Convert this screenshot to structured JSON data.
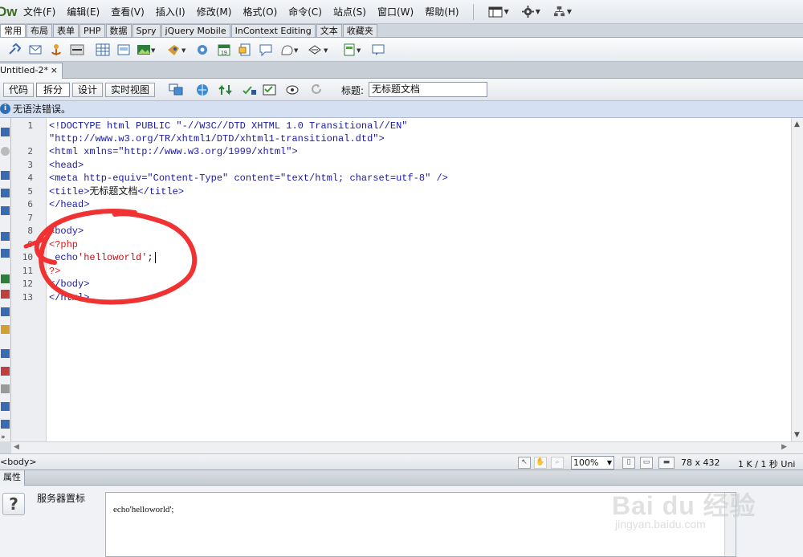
{
  "app": {
    "logo_text": "Dw"
  },
  "menu": {
    "items": [
      "文件(F)",
      "编辑(E)",
      "查看(V)",
      "插入(I)",
      "修改(M)",
      "格式(O)",
      "命令(C)",
      "站点(S)",
      "窗口(W)",
      "帮助(H)"
    ],
    "icons": [
      "layout-icon",
      "gear-icon",
      "site-icon"
    ]
  },
  "insert_bar": {
    "tabs": [
      "常用",
      "布局",
      "表单",
      "PHP",
      "数据",
      "Spry",
      "jQuery Mobile",
      "InContext Editing",
      "文本",
      "收藏夹"
    ],
    "active_tab": "常用"
  },
  "document": {
    "tab_label": "Untitled-2*",
    "close_glyph": "×"
  },
  "doc_toolbar": {
    "views": [
      "代码",
      "拆分",
      "设计",
      "实时视图"
    ],
    "active_view": "拆分",
    "title_label": "标题:",
    "title_value": "无标题文档"
  },
  "syntax_status": {
    "text": "无语法错误。"
  },
  "editor": {
    "line_numbers": [
      "1",
      "2",
      "3",
      "4",
      "5",
      "6",
      "7",
      "8",
      "9",
      "10",
      "11",
      "12",
      "13"
    ],
    "lines": {
      "l1a": "<!DOCTYPE html PUBLIC \"-//W3C//DTD XHTML 1.0 Transitional//EN\"",
      "l1b": "\"http://www.w3.org/TR/xhtml1/DTD/xhtml1-transitional.dtd\">",
      "l2": "<html xmlns=\"http://www.w3.org/1999/xhtml\">",
      "l3": "<head>",
      "l4": "<meta http-equiv=\"Content-Type\" content=\"text/html; charset=utf-8\" />",
      "l5a": "<title>",
      "l5b": "无标题文档",
      "l5c": "</title>",
      "l6": "</head>",
      "l8": "<body>",
      "l9": "<?php",
      "l10a": " echo",
      "l10b": "'helloworld'",
      "l10c": ";",
      "l11": "?>",
      "l12": "</body>",
      "l13": "</html>"
    },
    "annotation_color": "#f03232"
  },
  "status_bar": {
    "tag_selector": "<body>",
    "zoom": "100%",
    "window_size": "78 x 432",
    "file_size": "1 K / 1 秒 Uni"
  },
  "properties": {
    "header": "属性",
    "help_glyph": "?",
    "server_label": "服务器置标",
    "code_text": "echo'helloworld';"
  },
  "watermark": {
    "text": "Bai du 经验",
    "sub": "jingyan.baidu.com"
  }
}
